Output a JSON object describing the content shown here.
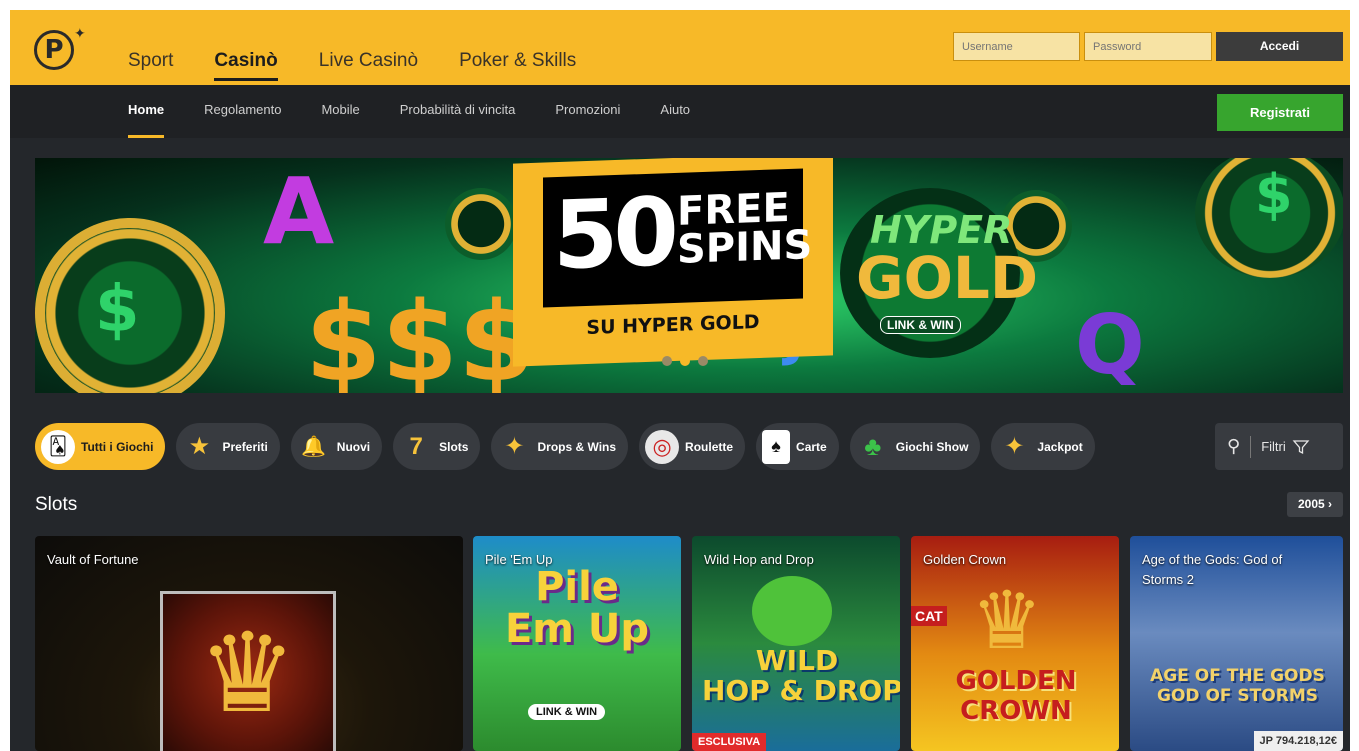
{
  "header": {
    "logo": "P",
    "nav": [
      "Sport",
      "Casinò",
      "Live Casinò",
      "Poker & Skills"
    ],
    "active_nav": "Casinò",
    "username_placeholder": "Username",
    "password_placeholder": "Password",
    "login_label": "Accedi"
  },
  "subnav": {
    "links": [
      "Home",
      "Regolamento",
      "Mobile",
      "Probabilità di vincita",
      "Promozioni",
      "Aiuto"
    ],
    "active": "Home",
    "register_label": "Registrati"
  },
  "banner": {
    "big_number": "50",
    "free": "FREE",
    "spins": "SPINS",
    "subtitle": "SU HYPER GOLD",
    "logo_line1": "HYPER",
    "logo_line2": "GOLD",
    "logo_line3": "LINK & WIN",
    "letter_a": "A",
    "letter_j": "J",
    "letter_q": "Q",
    "slides": 3,
    "active_slide": 1
  },
  "categories": [
    {
      "label": "Tutti i Giochi",
      "icon": "cards-dice-icon",
      "glyph": "🂡",
      "active": true
    },
    {
      "label": "Preferiti",
      "icon": "star-icon",
      "glyph": "★",
      "active": false
    },
    {
      "label": "Nuovi",
      "icon": "bell-icon",
      "glyph": "🔔",
      "active": false
    },
    {
      "label": "Slots",
      "icon": "seven-cherry-icon",
      "glyph": "7",
      "active": false
    },
    {
      "label": "Drops & Wins",
      "icon": "sparkle-icon",
      "glyph": "✦",
      "active": false
    },
    {
      "label": "Roulette",
      "icon": "roulette-icon",
      "glyph": "◎",
      "active": false
    },
    {
      "label": "Carte",
      "icon": "playing-cards-icon",
      "glyph": "♠",
      "active": false
    },
    {
      "label": "Giochi Show",
      "icon": "clover-icon",
      "glyph": "♣",
      "active": false
    },
    {
      "label": "Jackpot",
      "icon": "sparkle-icon",
      "glyph": "✦",
      "active": false
    }
  ],
  "filter": {
    "label": "Filtri"
  },
  "slots": {
    "title": "Slots",
    "count": "2005 ›",
    "games": [
      {
        "name": "Vault of Fortune"
      },
      {
        "name": "Pile 'Em Up",
        "art": "Pile\nEm Up",
        "badge_art": "LINK & WIN"
      },
      {
        "name": "Wild Hop and Drop",
        "art": "WILD\nHOP & DROP",
        "badge": "ESCLUSIVA"
      },
      {
        "name": "Golden Crown",
        "art": "GOLDEN\nCROWN",
        "side": "CAT"
      },
      {
        "name": "Age of the Gods: God of Storms 2",
        "art": "AGE OF THE GODS\nGOD OF STORMS",
        "jackpot": "JP 794.218,12€"
      }
    ]
  },
  "colors": {
    "brand_yellow": "#f7b928",
    "dark_bg": "#24272b",
    "register_green": "#37a52e",
    "chip_bg": "#383b40"
  }
}
